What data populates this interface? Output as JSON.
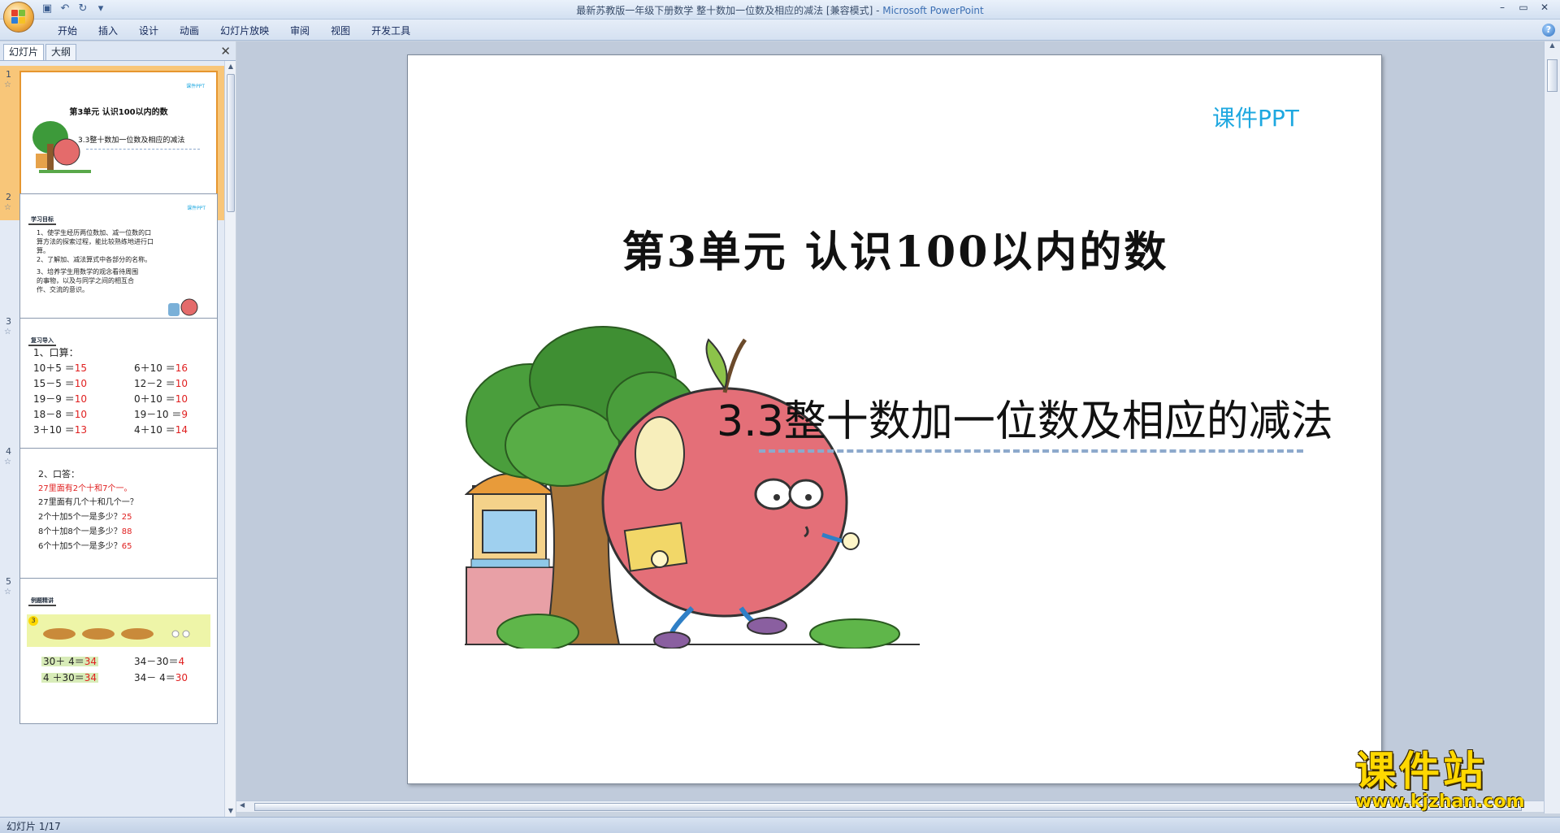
{
  "window": {
    "title": "最新苏教版一年级下册数学 整十数加一位数及相应的减法 [兼容模式]",
    "app_name": "Microsoft PowerPoint",
    "separator": " - "
  },
  "ribbon": {
    "tabs": [
      "开始",
      "插入",
      "设计",
      "动画",
      "幻灯片放映",
      "审阅",
      "视图",
      "开发工具"
    ]
  },
  "pane": {
    "tabs": [
      "幻灯片",
      "大纲"
    ],
    "active_tab": 0
  },
  "slides": [
    {
      "number": "1",
      "logo": "课件PPT",
      "title": "第3单元  认识100以内的数",
      "subtitle": "3.3整十数加一位数及相应的减法"
    },
    {
      "number": "2",
      "logo": "课件PPT",
      "badge": "学习目标",
      "lines": [
        "1、使学生经历两位数加、减一位数的口",
        "算方法的探索过程，能比较熟练地进行口",
        "算。",
        "2、了解加、减法算式中各部分的名称。",
        "3、培养学生用数学的观念看待周围",
        "的事物，以及与同学之间的相互合",
        "作、交流的意识。"
      ]
    },
    {
      "number": "3",
      "badge": "复习导入",
      "heading": "1、口算：",
      "left": [
        {
          "q": "10＋5 ＝",
          "a": "15"
        },
        {
          "q": "15－5 ＝",
          "a": "10"
        },
        {
          "q": "19－9 ＝",
          "a": "10"
        },
        {
          "q": "18－8 ＝",
          "a": "10"
        },
        {
          "q": "3＋10 ＝",
          "a": "13"
        }
      ],
      "right": [
        {
          "q": "6＋10 ＝",
          "a": "16"
        },
        {
          "q": "12－2 ＝",
          "a": "10"
        },
        {
          "q": "0＋10 ＝",
          "a": "10"
        },
        {
          "q": "19－10 ＝",
          "a": "9"
        },
        {
          "q": "4＋10 ＝",
          "a": "14"
        }
      ]
    },
    {
      "number": "4",
      "heading": "2、口答：",
      "red_line": "27里面有2个十和7个一。",
      "lines": [
        {
          "q": "27里面有几个十和几个一？",
          "a": ""
        },
        {
          "q": "2个十加5个一是多少？",
          "a": "25"
        },
        {
          "q": "8个十加8个一是多少？",
          "a": "88"
        },
        {
          "q": "6个十加5个一是多少？",
          "a": "65"
        }
      ]
    },
    {
      "number": "5",
      "badge": "例题精讲",
      "circle_label": "3",
      "eq1_left": "30＋ 4＝",
      "eq1_left_a": "34",
      "eq1_right": "34－30＝",
      "eq1_right_a": "4",
      "eq2_left": "4 ＋30＝",
      "eq2_left_a": "34",
      "eq2_right": "34－ 4＝",
      "eq2_right_a": "30"
    }
  ],
  "main_slide": {
    "logo": "课件PPT",
    "title": "第3单元  认识100以内的数",
    "subtitle": "3.3整十数加一位数及相应的减法"
  },
  "status_bar": {
    "slide_info": "幻灯片 1/17"
  },
  "site_logo": {
    "name": "课件站",
    "url": "www.kjzhan.com"
  },
  "colors": {
    "accent_blue": "#1ea8e0",
    "answer_red": "#e02020",
    "selection": "#f8c679"
  }
}
